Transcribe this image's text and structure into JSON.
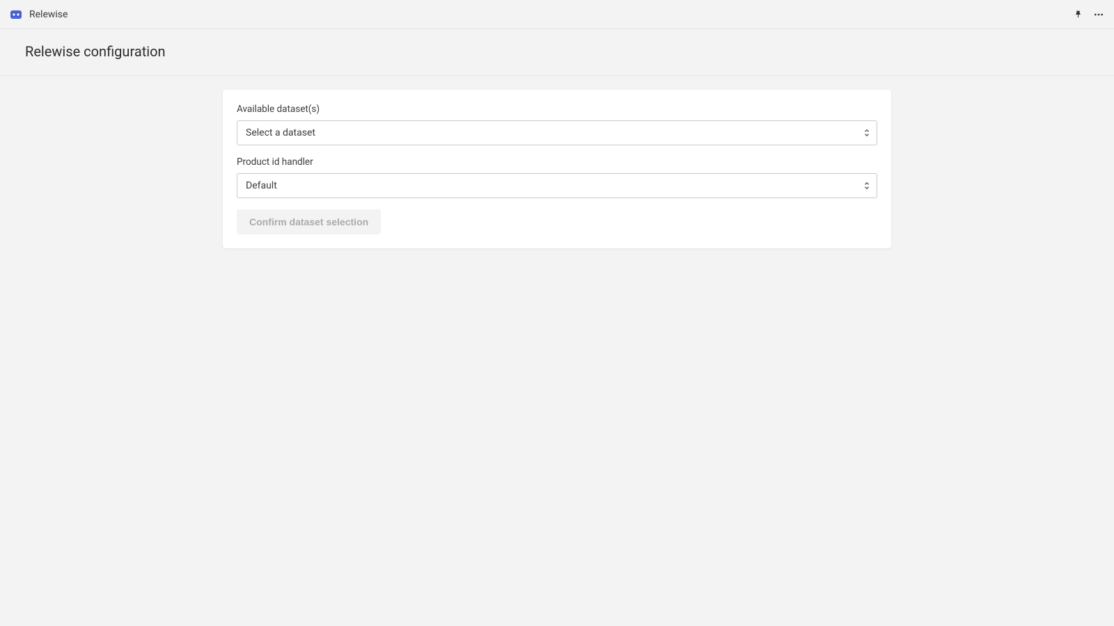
{
  "header": {
    "app_name": "Relewise"
  },
  "page": {
    "title": "Relewise configuration"
  },
  "form": {
    "dataset": {
      "label": "Available dataset(s)",
      "placeholder": "Select a dataset"
    },
    "handler": {
      "label": "Product id handler",
      "value": "Default"
    },
    "confirm_button": "Confirm dataset selection"
  }
}
